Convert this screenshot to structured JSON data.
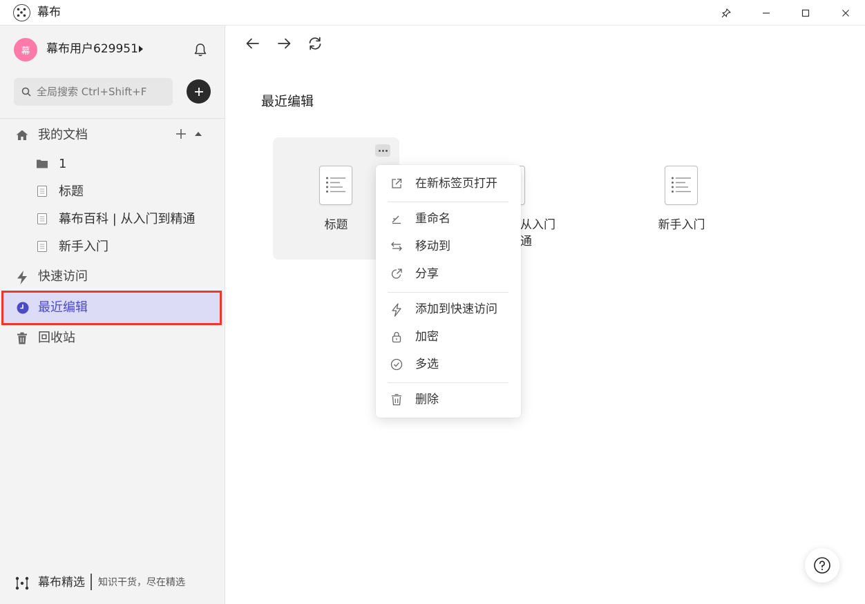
{
  "window": {
    "title": "幕布",
    "controls": {
      "pin": "pin-icon",
      "minimize": "minimize-icon",
      "maximize": "maximize-icon",
      "close": "close-icon"
    }
  },
  "sidebar": {
    "user": {
      "avatar_text": "幕",
      "avatar_color": "#ff7aa8",
      "name": "幕布用户629951"
    },
    "search": {
      "placeholder": "全局搜索 Ctrl+Shift+F"
    },
    "my_docs": {
      "label": "我的文档",
      "items": [
        {
          "label": "1",
          "icon": "folder-icon"
        },
        {
          "label": "标题",
          "icon": "document-icon"
        },
        {
          "label": "幕布百科 | 从入门到精通",
          "icon": "document-icon"
        },
        {
          "label": "新手入门",
          "icon": "document-icon"
        }
      ]
    },
    "nav": {
      "quick_access": "快速访问",
      "recent": "最近编辑",
      "trash": "回收站"
    },
    "active_item": "最近编辑",
    "footer": {
      "brand": "幕布精选",
      "slogan": "知识干货，尽在精选"
    }
  },
  "main": {
    "section_title": "最近编辑",
    "cards": [
      {
        "title": "标题"
      },
      {
        "title_line1": "从入门",
        "title_line2": "通"
      },
      {
        "title": "新手入门"
      }
    ]
  },
  "context_menu": {
    "items": [
      {
        "label": "在新标签页打开",
        "icon": "open-external-icon"
      },
      {
        "label": "重命名",
        "icon": "rename-icon"
      },
      {
        "label": "移动到",
        "icon": "move-icon"
      },
      {
        "label": "分享",
        "icon": "share-icon"
      },
      {
        "label": "添加到快速访问",
        "icon": "lightning-icon"
      },
      {
        "label": "加密",
        "icon": "lock-icon"
      },
      {
        "label": "多选",
        "icon": "check-circle-icon"
      },
      {
        "label": "删除",
        "icon": "trash-icon"
      }
    ]
  },
  "colors": {
    "accent": "#4b4bc6",
    "active_bg": "#dcdcf6",
    "highlight_border": "#f0352b"
  }
}
